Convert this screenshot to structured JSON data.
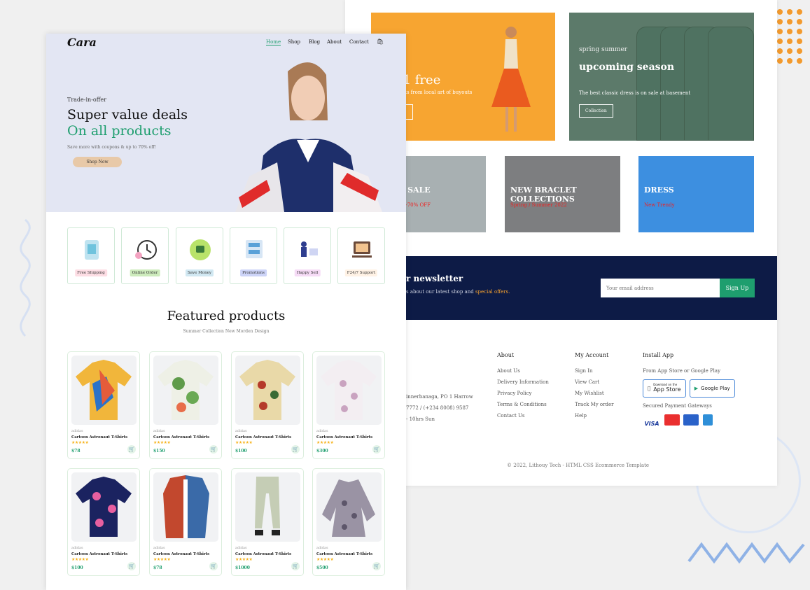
{
  "colors": {
    "accent": "#1e9e6e",
    "navy": "#0d1b46",
    "orange": "#f6a22e",
    "sale_red": "#ef2020"
  },
  "back": {
    "banner_yellow": {
      "heading": "et 1 free",
      "sub": "ew shirts from local art of buyouts"
    },
    "banner_green": {
      "eyebrow": "spring summer",
      "heading": "upcoming season",
      "sub": "The best classic dress is on sale at basement",
      "button": "Collection"
    },
    "small_banners": [
      {
        "heading": "AL SALE",
        "sub": "olen -70% OFF"
      },
      {
        "heading": "NEW BRACLET COLLECTIONS",
        "sub": "Spring / Summer 2022"
      },
      {
        "heading": "DRESS",
        "sub": "New Trendy"
      }
    ],
    "newsletter": {
      "heading": "r newsletter",
      "text": "s about our latest shop and ",
      "highlight": "special offers.",
      "placeholder": "Your email address",
      "button": "Sign Up"
    },
    "footer": {
      "contact": [
        "innerbanaga, PO 1 Harrow",
        "7772 / (+234 8008) 9587",
        "- 10hrs Sun"
      ],
      "about": {
        "title": "About",
        "items": [
          "About Us",
          "Delivery Information",
          "Privacy Policy",
          "Terms & Conditions",
          "Contact Us"
        ]
      },
      "account": {
        "title": "My Account",
        "items": [
          "Sign In",
          "View Cart",
          "My Wishlist",
          "Track My order",
          "Help"
        ]
      },
      "install": {
        "title": "Install App",
        "text": "From App Store or Google Play",
        "appstore_small": "Download on the",
        "appstore": "App Store",
        "googleplay": "Google Play",
        "secured": "Secured Payment Gateways"
      },
      "payments": [
        "VISA",
        "MC",
        "ME",
        "AMEX"
      ],
      "copyright": "© 2022, Lithouy Tech - HTML CSS Ecommerce Template"
    }
  },
  "front": {
    "logo": "Cara",
    "nav": [
      "Home",
      "Shop",
      "Blog",
      "About",
      "Contact"
    ],
    "hero": {
      "eyebrow": "Trade-in-offer",
      "line1": "Super value deals",
      "line2": "On all products",
      "sub": "Save more with coupons & up to 70% off!",
      "button": "Shop Now"
    },
    "features": [
      {
        "label": "Free Shipping",
        "bg": "#fddde4"
      },
      {
        "label": "Online Order",
        "bg": "#cdebbc"
      },
      {
        "label": "Save Money",
        "bg": "#d1e8f2"
      },
      {
        "label": "Promotions",
        "bg": "#cdd4f8"
      },
      {
        "label": "Happy Sell",
        "bg": "#f6dbf6"
      },
      {
        "label": "F24/7 Support",
        "bg": "#fff2e5"
      }
    ],
    "featured_title": "Featured products",
    "featured_sub": "Summer Collection New Morden Design",
    "products": [
      {
        "brand": "adidas",
        "name": "Cartoon Astronaut T-Shirts",
        "stars": "★★★★★",
        "price": "$78"
      },
      {
        "brand": "adidas",
        "name": "Cartoon Astronaut T-Shirts",
        "stars": "★★★★★",
        "price": "$150"
      },
      {
        "brand": "adidas",
        "name": "Cartoon Astronaut T-Shirts",
        "stars": "★★★★★",
        "price": "$100"
      },
      {
        "brand": "adidas",
        "name": "Cartoon Astronaut T-Shirts",
        "stars": "★★★★★",
        "price": "$300"
      },
      {
        "brand": "adidas",
        "name": "Cartoon Astronaut T-Shirts",
        "stars": "★★★★★",
        "price": "$100"
      },
      {
        "brand": "adidas",
        "name": "Cartoon Astronaut T-Shirts",
        "stars": "★★★★★",
        "price": "$78"
      },
      {
        "brand": "adidas",
        "name": "Cartoon Astronaut T-Shirts",
        "stars": "★★★★★",
        "price": "$1000"
      },
      {
        "brand": "adidas",
        "name": "Cartoon Astronaut T-Shirts",
        "stars": "★★★★★",
        "price": "$500"
      }
    ]
  }
}
